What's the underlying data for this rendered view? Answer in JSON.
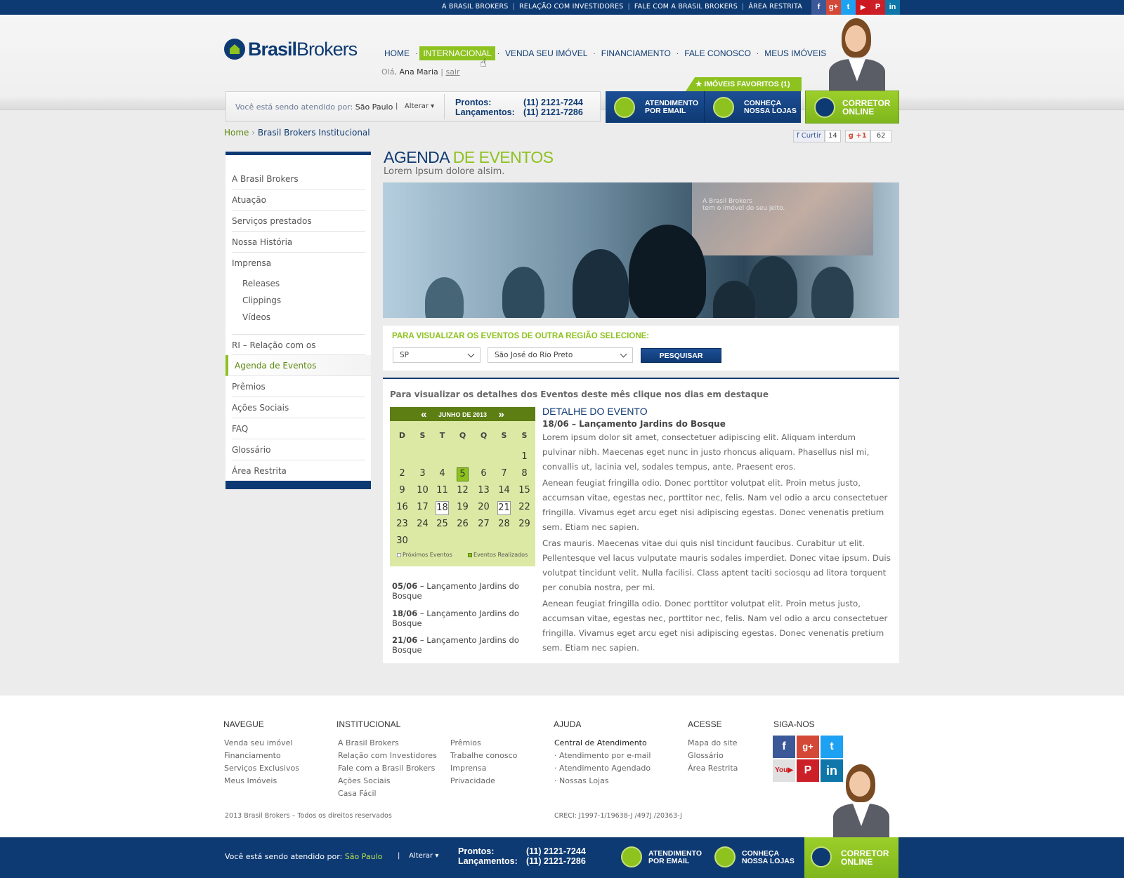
{
  "top_links": [
    "A BRASIL BROKERS",
    "RELAÇÃO COM INVESTIDORES",
    "FALE COM A BRASIL BROKERS",
    "ÁREA RESTRITA"
  ],
  "social_icons": [
    "facebook-icon",
    "google-plus-icon",
    "twitter-icon",
    "youtube-icon",
    "pinterest-icon",
    "linkedin-icon"
  ],
  "logo": {
    "bold": "Brasil",
    "light": "Brokers"
  },
  "nav": [
    "HOME",
    "INTERNACIONAL",
    "VENDA SEU IMÓVEL",
    "FINANCIAMENTO",
    "FALE CONOSCO",
    "MEUS IMÓVEIS"
  ],
  "greeting": {
    "prefix": "Olá,",
    "name": "Ana Maria",
    "sep": "|",
    "logout": "sair"
  },
  "favorites": "★ IMÓVEIS FAVORITOS (1)",
  "service": {
    "label": "Você está sendo atendido por:",
    "city": "São Paulo",
    "change": "Alterar",
    "prontos_label": "Prontos:",
    "prontos_phone": "(11) 2121-7244",
    "lanc_label": "Lançamentos:",
    "lanc_phone": "(11) 2121-7286",
    "email_l1": "ATENDIMENTO",
    "email_l2": "POR EMAIL",
    "stores_l1": "CONHEÇA",
    "stores_l2": "NOSSA LOJAS",
    "online_l1": "CORRETOR",
    "online_l2": "ONLINE"
  },
  "breadcrumb": {
    "home": "Home",
    "current": "Brasil Brokers Institucional"
  },
  "share": {
    "like": "Curtir",
    "like_count": "14",
    "plus": "+1",
    "plus_count": "62"
  },
  "sidebar": {
    "items": [
      "A Brasil Brokers",
      "Atuação",
      "Serviços prestados",
      "Nossa História",
      "Imprensa"
    ],
    "subitems": [
      "Releases",
      "Clippings",
      "Vídeos"
    ],
    "items2": [
      "RI – Relação com os Investidores",
      "Agenda de Eventos",
      "Prêmios",
      "Ações Sociais",
      "FAQ",
      "Glossário",
      "Área Restrita"
    ],
    "active": "Agenda de Eventos"
  },
  "page": {
    "title_a": "AGENDA",
    "title_b": "DE EVENTOS",
    "subtitle": "Lorem Ipsum dolore alsim."
  },
  "banner_text": [
    "A Brasil Brokers",
    "tem o imóvel do seu jeito."
  ],
  "filter": {
    "title": "PARA VISUALIZAR OS EVENTOS DE OUTRA REGIÃO SELECIONE:",
    "state": "SP",
    "city": "São José do Rio Preto",
    "button": "PESQUISAR"
  },
  "events": {
    "instruction": "Para visualizar os detalhes dos Eventos deste mês clique nos dias em destaque",
    "calendar": {
      "month": "JUNHO DE 2013",
      "prev": "«",
      "next": "»",
      "weekdays": [
        "D",
        "S",
        "T",
        "Q",
        "Q",
        "S",
        "S"
      ],
      "first_weekday": 6,
      "days_in_month": 30,
      "realized": [
        5
      ],
      "upcoming": [
        18,
        21
      ],
      "legend_next": "Próximos Eventos",
      "legend_done": "Eventos Realizados"
    },
    "list": [
      {
        "date": "05/06",
        "text": "– Lançamento Jardins do Bosque"
      },
      {
        "date": "18/06",
        "text": "– Lançamento Jardins do Bosque"
      },
      {
        "date": "21/06",
        "text": "– Lançamento Jardins do Bosque"
      }
    ],
    "detail": {
      "heading": "DETALHE DO EVENTO",
      "subheading": "18/06 – Lançamento Jardins do Bosque",
      "paragraphs": [
        "Lorem ipsum dolor sit amet, consectetuer adipiscing elit. Aliquam interdum pulvinar nibh. Maecenas eget nunc in justo rhoncus aliquam. Phasellus nisl mi, convallis ut, lacinia vel, sodales tempus, ante. Praesent eros.",
        "Aenean feugiat fringilla odio. Donec porttitor volutpat elit. Proin metus justo, accumsan vitae, egestas nec, porttitor nec, felis. Nam vel odio a arcu consectetuer fringilla. Vivamus eget arcu eget nisi adipiscing egestas. Donec venenatis pretium sem. Etiam nec sapien.",
        "Cras mauris. Maecenas vitae dui quis nisl tincidunt faucibus. Curabitur ut elit. Pellentesque vel lacus vulputate mauris sodales imperdiet. Donec vitae ipsum. Duis volutpat tincidunt velit. Nulla facilisi. Class aptent taciti sociosqu ad litora torquent per conubia nostra, per mi.",
        "Aenean feugiat fringilla odio. Donec porttitor volutpat elit. Proin metus justo, accumsan vitae, egestas nec, porttitor nec, felis. Nam vel odio a arcu consectetuer fringilla. Vivamus eget arcu eget nisi adipiscing egestas. Donec venenatis pretium sem. Etiam nec sapien."
      ]
    }
  },
  "footer": {
    "navegue": {
      "title": "NAVEGUE",
      "links": [
        "Venda seu imóvel",
        "Financiamento",
        "Serviços Exclusivos",
        "Meus Imóveis"
      ]
    },
    "institucional": {
      "title": "INSTITUCIONAL",
      "col1": [
        "A Brasil Brokers",
        "Relação com Investidores",
        "Fale com a Brasil Brokers",
        "Ações Sociais",
        "Casa Fácil"
      ],
      "col2": [
        "Prêmios",
        "Trabalhe conosco",
        "Imprensa",
        "Privacidade"
      ]
    },
    "ajuda": {
      "title": "AJUDA",
      "links": [
        "Central de Atendimento",
        "· Atendimento por e-mail",
        "· Atendimento Agendado",
        "· Nossas Lojas"
      ]
    },
    "acesse": {
      "title": "ACESSE",
      "links": [
        "Mapa do site",
        "Glossário",
        "Área Restrita"
      ]
    },
    "siga": {
      "title": "SIGA-NOS"
    },
    "copyright": "2013 Brasil Brokers – Todos os direitos reservados",
    "creci": "CRECI: J1997-1/19638-J /497J /20363-J"
  },
  "bottom": {
    "label": "Você está sendo atendido por:",
    "city": "São Paulo",
    "change": "Alterar"
  },
  "colors": {
    "brand_blue": "#0e3a73",
    "brand_green": "#8dc21f",
    "dark_green": "#5c7e13"
  }
}
